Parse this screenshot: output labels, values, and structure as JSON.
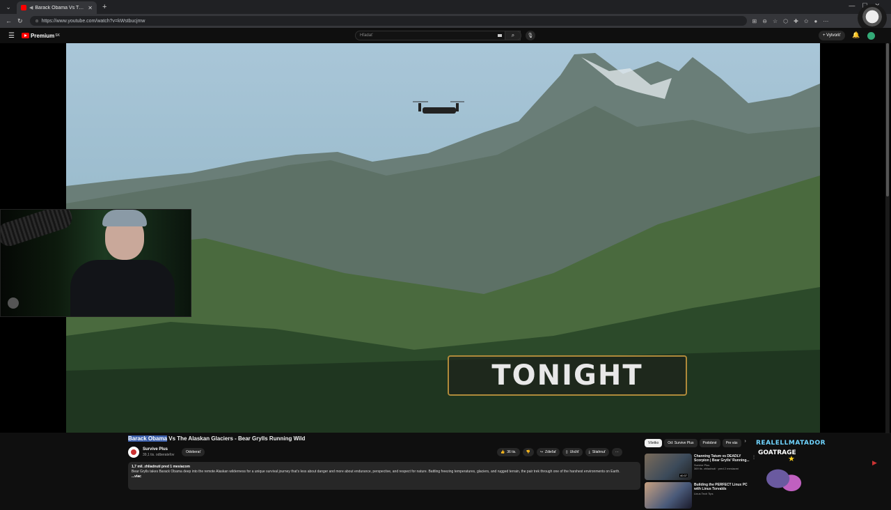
{
  "browser": {
    "tab_title": "Barack Obama Vs The Alaskan",
    "url": "https://www.youtube.com/watch?v=kWstbucjmw"
  },
  "youtube": {
    "logo_text": "Premium",
    "logo_sup": "SK",
    "search_placeholder": "Hľadať",
    "create_label": "Vytvoriť"
  },
  "player": {
    "overlay_text": "TONIGHT"
  },
  "video": {
    "title_highlight": "Barack Obama",
    "title_rest": " Vs The Alaskan Glaciers - Bear Grylls Running Wild",
    "channel": "Survive Plus",
    "subscribers": "39,1 tis. odberateľov",
    "subscribe_label": "Odoberať",
    "likes": "36 tis.",
    "share_label": "Zdieľať",
    "save_label": "Uložiť",
    "download_label": "Stiahnuť",
    "views_line": "1,7 mil. zhliadnutí  pred 1 mesiacom",
    "description": "Bear Grylls takes Barack Obama deep into the remote Alaskan wilderness for a unique survival journey that's less about danger and more about endurance, perspective, and respect for nature. Battling freezing temperatures, glaciers, and rugged terrain, the pair trek through one of the harshest environments on Earth.",
    "more_label": "...viac"
  },
  "sidebar": {
    "chips": [
      {
        "label": "Všetko",
        "active": true
      },
      {
        "label": "Od: Survive Plus",
        "active": false
      },
      {
        "label": "Podobné",
        "active": false
      },
      {
        "label": "Pre vás",
        "active": false
      }
    ],
    "recommendations": [
      {
        "title": "Channing Tatum vs DEADLY Scorpion | Bear Grylls' Running...",
        "channel": "Survive Plus",
        "meta": "369 tis. zhliadnutí · pred 2 mesiacmi",
        "duration": "40:37"
      },
      {
        "title": "Building the PERFECT Linux PC with Linus Torvalds",
        "channel": "Linus Tech Tips",
        "meta": "",
        "duration": ""
      }
    ]
  },
  "stream_overlay": {
    "name": "REALELLMATADOR",
    "label": "GOATRAGE"
  },
  "colors": {
    "background": "#0f0f0f",
    "youtube_red": "#ff0000",
    "highlight": "#3a5ea9",
    "overlay_cyan": "#6fd4ff"
  }
}
